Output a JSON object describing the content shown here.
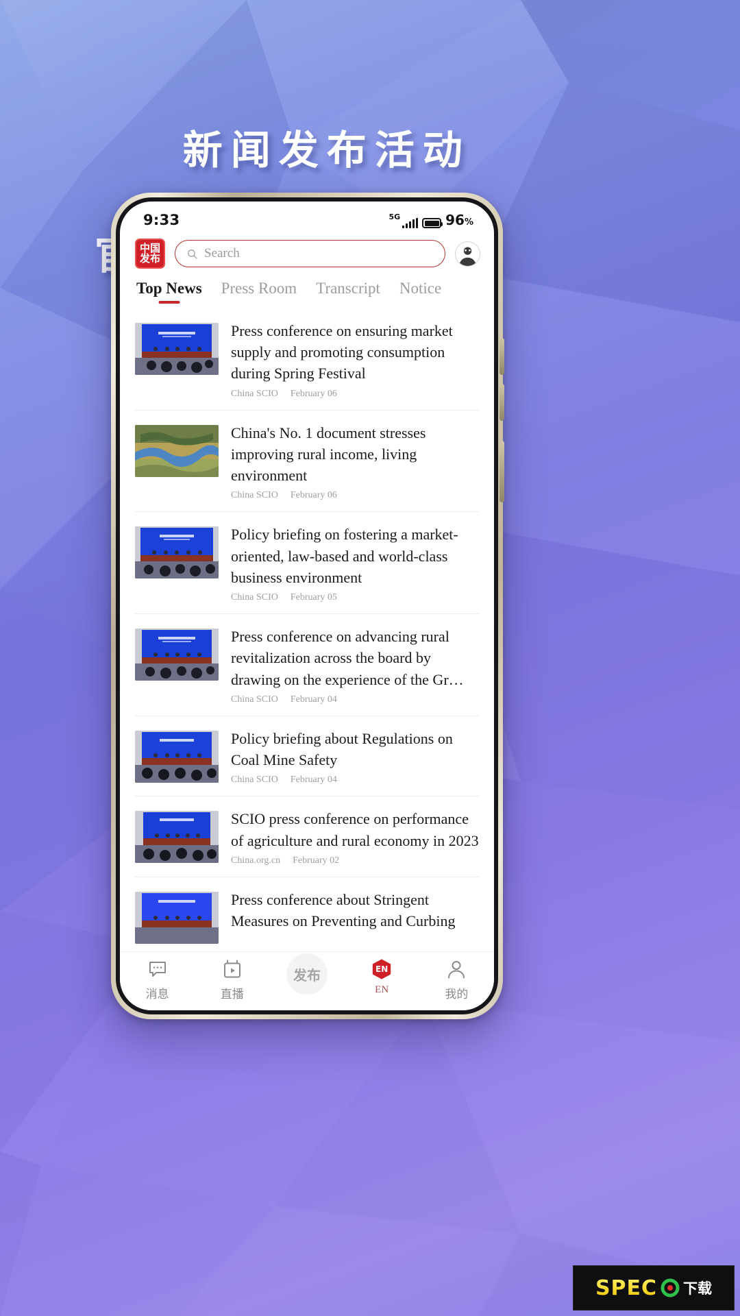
{
  "poster": {
    "headline_line1": "新闻发布活动",
    "headline_line2": "官方英文报道",
    "background_accent": "#7b79e0"
  },
  "phone": {
    "statusbar": {
      "time": "9:33",
      "network": "5G",
      "battery_percent": "96",
      "percent_symbol": "%"
    },
    "appbar": {
      "logo_line1": "中国",
      "logo_line2": "发布",
      "logo_color": "#cf2027",
      "search_placeholder": "Search",
      "search_icon": "search-icon",
      "avatar_icon": "user-avatar-icon"
    },
    "tabs": [
      {
        "label": "Top News",
        "active": true
      },
      {
        "label": "Press Room",
        "active": false
      },
      {
        "label": "Transcript",
        "active": false
      },
      {
        "label": "Notice",
        "active": false
      }
    ],
    "accent_color": "#c62828",
    "news": [
      {
        "title": "Press conference on ensuring market supply and promoting consumption during Spring Festival",
        "source": "China SCIO",
        "date": "February 06",
        "thumb": "press-conference-blue"
      },
      {
        "title": "China's No. 1 document stresses improving rural income, living environment",
        "source": "China SCIO",
        "date": "February 06",
        "thumb": "rural-river-landscape"
      },
      {
        "title": "Policy briefing on fostering a market-oriented, law-based and world-class business environment",
        "source": "China SCIO",
        "date": "February 05",
        "thumb": "press-conference-blue"
      },
      {
        "title": "Press conference on advancing rural revitalization across the board by drawing on the experience of the Gr…",
        "source": "China SCIO",
        "date": "February 04",
        "thumb": "press-conference-blue"
      },
      {
        "title": "Policy briefing about Regulations on Coal Mine Safety",
        "source": "China SCIO",
        "date": "February 04",
        "thumb": "press-conference-blue"
      },
      {
        "title": "SCIO press conference on performance of agriculture and rural economy in 2023",
        "source": "China.org.cn",
        "date": "February 02",
        "thumb": "press-conference-blue"
      },
      {
        "title": "Press conference about Stringent Measures on Preventing and Curbing",
        "source": "",
        "date": "",
        "thumb": "press-conference-blue"
      }
    ],
    "bottomnav": [
      {
        "label": "消息",
        "icon": "message-bubble-icon"
      },
      {
        "label": "直播",
        "icon": "live-video-icon"
      },
      {
        "label": "发布",
        "icon": "publish-button"
      },
      {
        "label": "EN",
        "icon": "language-en-icon"
      },
      {
        "label": "我的",
        "icon": "profile-person-icon"
      }
    ]
  },
  "watermark": {
    "brand": "SPEC",
    "brand2": "O",
    "suffix": "下载"
  }
}
